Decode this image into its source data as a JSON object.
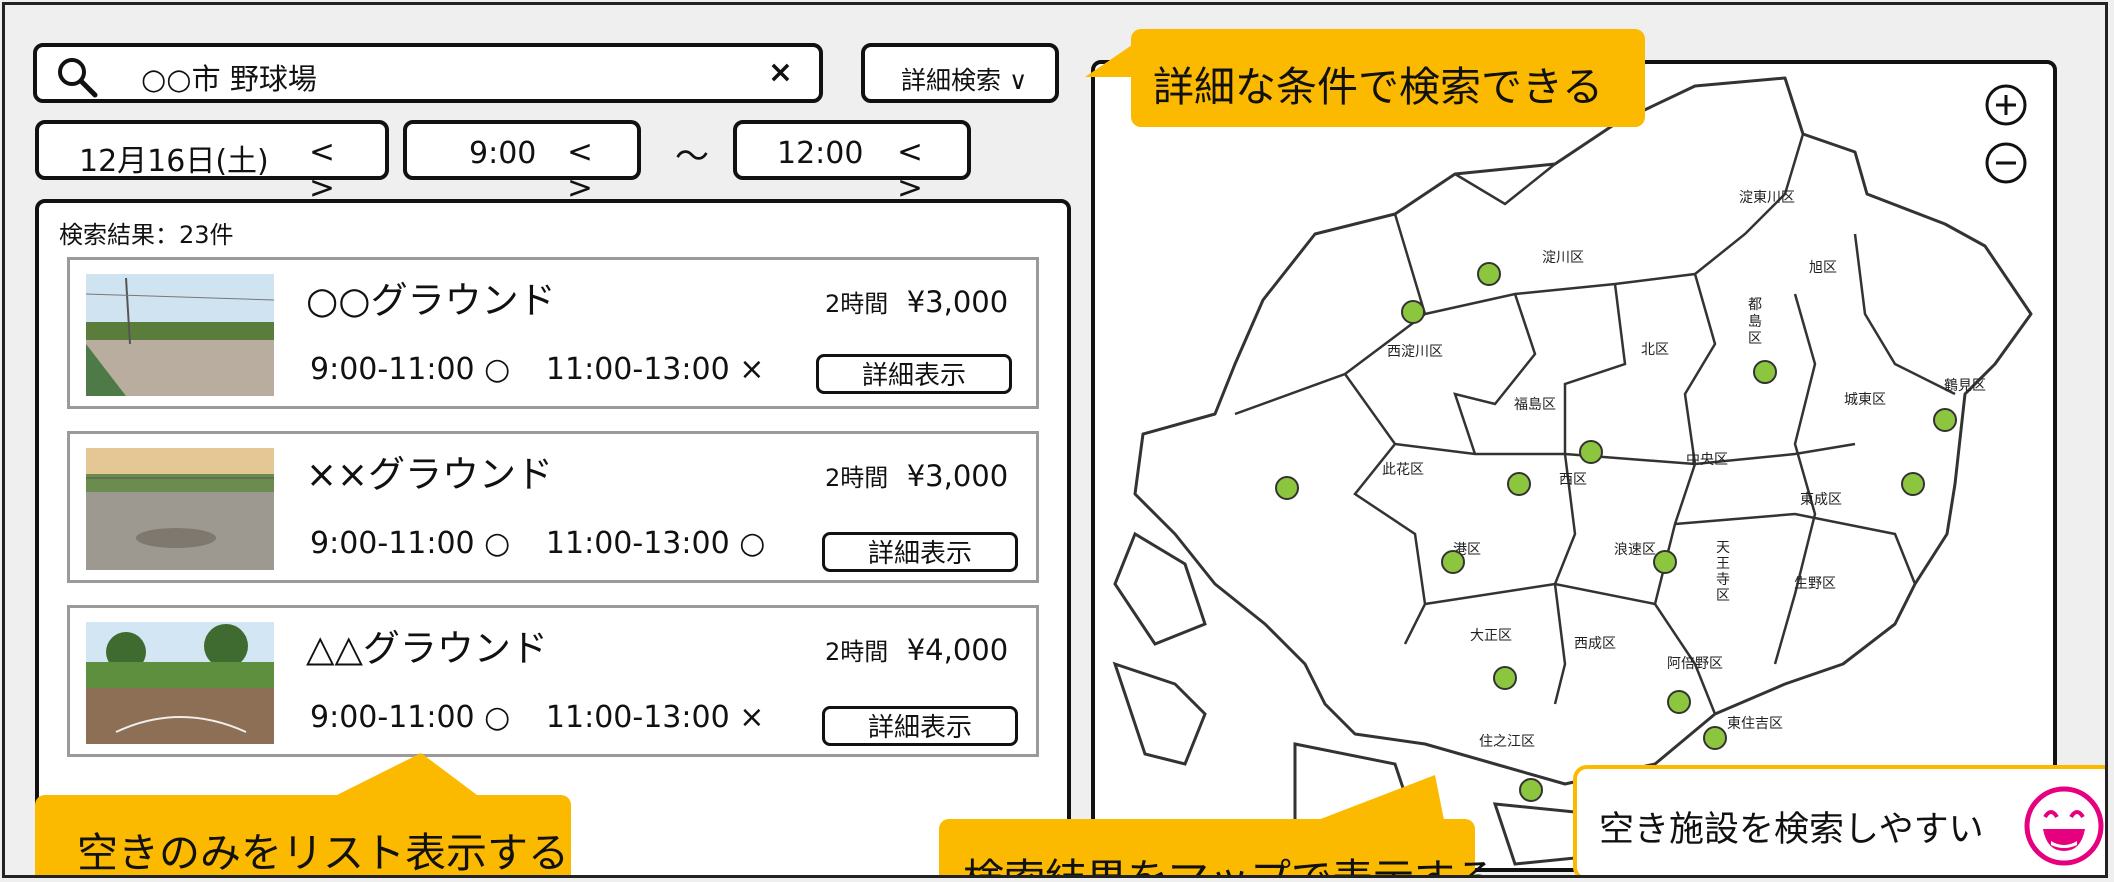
{
  "search": {
    "query": "○○市  野球場",
    "clear_label": "×",
    "detail_label": "詳細検索 ∨"
  },
  "filters": {
    "date": "12月16日(土)",
    "start_time": "9:00",
    "end_time": "12:00",
    "nav": "< >",
    "separator": "～"
  },
  "results": {
    "count_label": "検索結果：23件",
    "items": [
      {
        "name": "○○グラウンド",
        "duration": "2時間",
        "price": "¥3,000",
        "slot1": "9:00-11:00 ○",
        "slot2": "11:00-13:00 ×",
        "button": "詳細表示"
      },
      {
        "name": "××グラウンド",
        "duration": "2時間",
        "price": "¥3,000",
        "slot1": "9:00-11:00 ○",
        "slot2": "11:00-13:00 ○",
        "button": "詳細表示"
      },
      {
        "name": "△△グラウンド",
        "duration": "2時間",
        "price": "¥4,000",
        "slot1": "9:00-11:00 ○",
        "slot2": "11:00-13:00 ×",
        "button": "詳細表示"
      }
    ]
  },
  "map": {
    "wards": [
      "淀東川区",
      "淀川区",
      "旭区",
      "西淀川区",
      "北区",
      "都島区",
      "福島区",
      "城東区",
      "鶴見区",
      "此花区",
      "西区",
      "中央区",
      "東成区",
      "港区",
      "浪速区",
      "天王寺区",
      "生野区",
      "大正区",
      "西成区",
      "阿倍野区",
      "住之江区",
      "東住吉区"
    ],
    "zoom_in": "+",
    "zoom_out": "−",
    "marker_color": "#8cc63f"
  },
  "callouts": {
    "detail": "詳細な条件で検索できる",
    "list": "空きのみをリスト表示する",
    "map": "検索結果をマップで表示する",
    "easy": "空き施設を検索しやすい"
  },
  "colors": {
    "callout": "#fbba00",
    "smiley": "#e6007e"
  }
}
